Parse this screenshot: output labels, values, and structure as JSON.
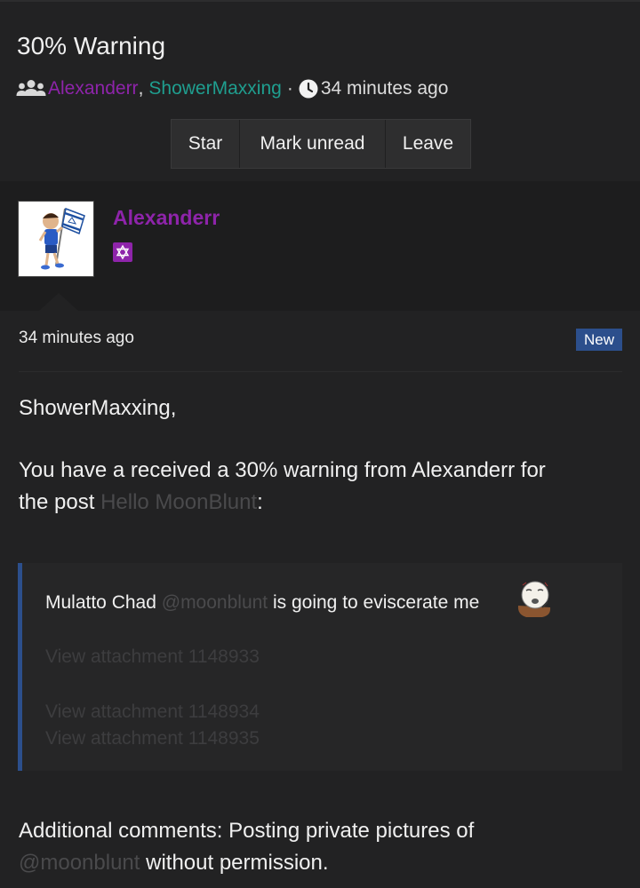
{
  "conversation": {
    "title": "30% Warning",
    "participants": [
      "Alexanderr",
      "ShowerMaxxing"
    ],
    "separator": "·",
    "comma": ",",
    "time": "34 minutes ago",
    "icons": {
      "participants": "users-icon",
      "time": "clock-icon"
    }
  },
  "actions": [
    "Star",
    "Mark unread",
    "Leave"
  ],
  "author": {
    "name": "Alexanderr",
    "badge_icon": "star-of-david-icon",
    "name_color": "#8e24aa"
  },
  "message": {
    "time": "34 minutes ago",
    "new_label": "New",
    "greeting": "ShowerMaxxing,",
    "intro": "You have a received a 30% warning from Alexanderr for",
    "intro2": "the post ",
    "post_link": "Hello MoonBlunt",
    "colon": ":",
    "quote": {
      "text_before": "Mulatto Chad ",
      "mention": "@moonblunt",
      "text_after": " is going to eviscerate me",
      "attachments": [
        "View attachment 1148933",
        "View attachment 1148934",
        "View attachment 1148935"
      ]
    },
    "additional_prefix": "Additional comments: Posting private pictures of",
    "additional_mention": "@moonblunt",
    "additional_suffix": " without permission."
  },
  "colors": {
    "accent": "#2c4f8c",
    "user_purple": "#8e24aa",
    "user_teal": "#1f9e8f",
    "background": "#222223"
  }
}
